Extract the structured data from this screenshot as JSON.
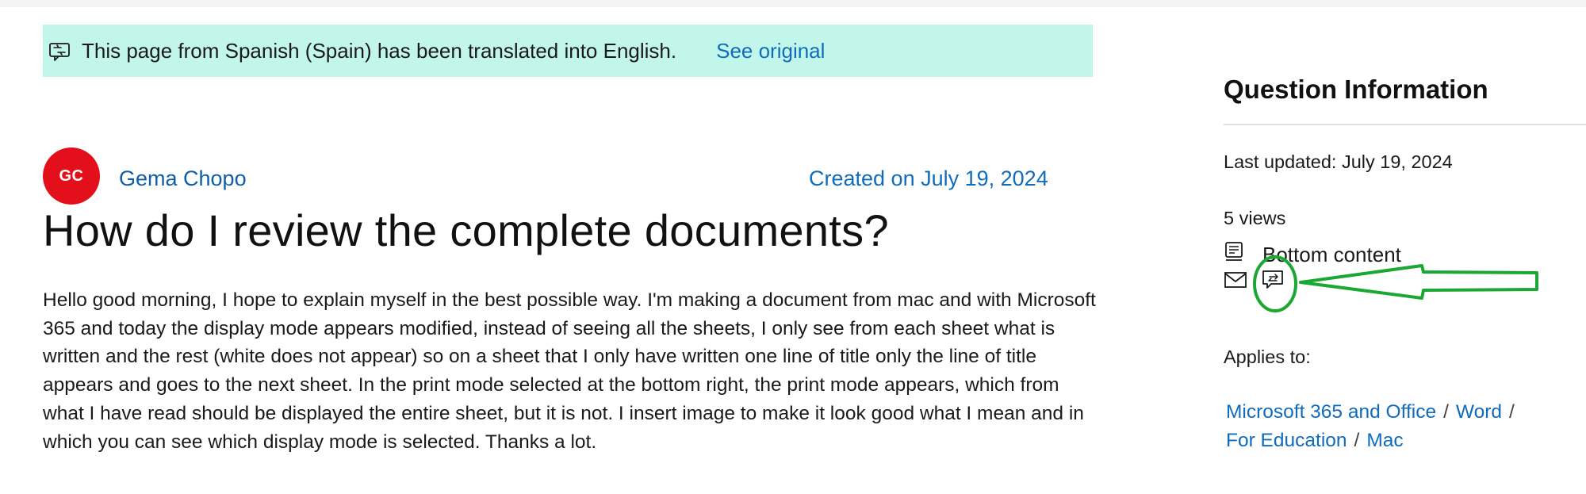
{
  "banner": {
    "icon": "translate-icon",
    "text": "This page from Spanish (Spain) has been translated into English.",
    "link": "See original"
  },
  "author": {
    "initials": "GC",
    "avatar_color": "#e3101b",
    "name": "Gema Chopo"
  },
  "created_on": "Created on July 19, 2024",
  "question": {
    "title": "How do I review the complete documents?",
    "body": "Hello good morning, I hope to explain myself in the best possible way. I'm making a document from mac and with Microsoft 365 and today the display mode appears modified, instead of seeing all the sheets, I only see from each sheet what is written and the rest (white does not appear) so on a sheet that I only have written one line of title only the line of title appears and goes to the next sheet. In the print mode selected at the bottom right, the print mode appears, which from what I have read should be displayed the entire sheet, but it is not. I insert image to make it look good what I mean and in which you can see which display mode is selected. Thanks a lot."
  },
  "sidebar": {
    "title": "Question Information",
    "last_updated": "Last updated: July 19, 2024",
    "views": "5 views",
    "bottom_content": {
      "icon": "document-lines-icon",
      "label": "Bottom content"
    },
    "actions": [
      {
        "icon": "mail-icon"
      },
      {
        "icon": "feedback-chat-icon"
      }
    ],
    "applies_to_label": "Applies to:",
    "tags": [
      "Microsoft 365 and Office",
      "Word",
      "For Education",
      "Mac"
    ],
    "tag_separator": "/"
  },
  "annotation": {
    "color": "#1aa832",
    "shapes": [
      "circle",
      "arrow-left"
    ]
  },
  "colors": {
    "banner_bg": "#c2f6ea",
    "link": "#0f6cbd",
    "author_link": "#0f5ea8"
  }
}
